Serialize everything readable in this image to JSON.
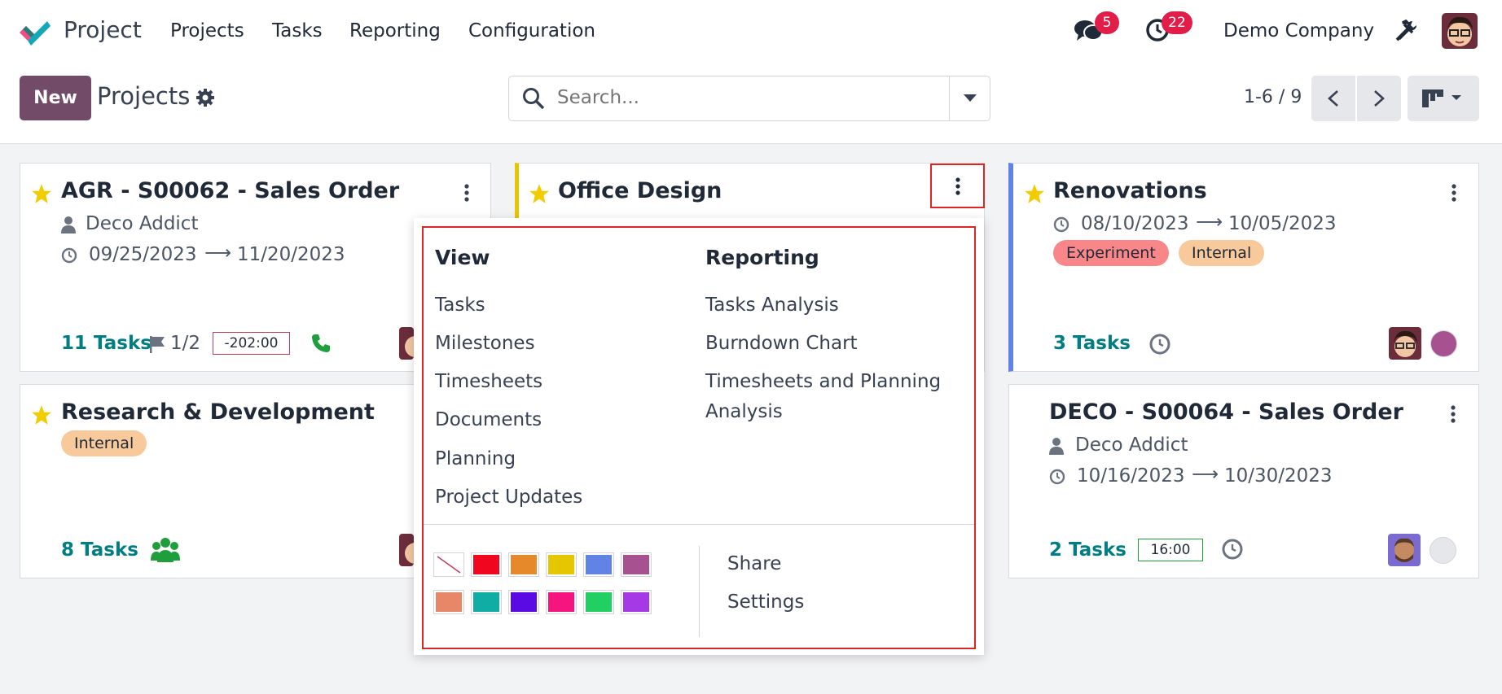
{
  "navbar": {
    "app_name": "Project",
    "menu": [
      "Projects",
      "Tasks",
      "Reporting",
      "Configuration"
    ],
    "messages_count": "5",
    "activities_count": "22",
    "company": "Demo Company"
  },
  "control_panel": {
    "new_label": "New",
    "breadcrumb": "Projects",
    "search_placeholder": "Search...",
    "pager": "1-6 / 9"
  },
  "cards": [
    {
      "title": "AGR - S00062 - Sales Order",
      "customer": "Deco Addict",
      "date_start": "09/25/2023",
      "date_end": "11/20/2023",
      "tasks": "11 Tasks",
      "milestones": "1/2",
      "hours": "-202:00"
    },
    {
      "title": "Office Design"
    },
    {
      "title": "Renovations",
      "date_start": "08/10/2023",
      "date_end": "10/05/2023",
      "tags": [
        "Experiment",
        "Internal"
      ],
      "tasks": "3 Tasks"
    },
    {
      "title": "Research & Development",
      "tags": [
        "Internal"
      ],
      "tasks": "8 Tasks"
    },
    {
      "title": "DECO - S00064 - Sales Order",
      "customer": "Deco Addict",
      "date_start": "10/16/2023",
      "date_end": "10/30/2023",
      "tasks": "2 Tasks",
      "hours": "16:00"
    }
  ],
  "dropdown": {
    "view_heading": "View",
    "view_items": [
      "Tasks",
      "Milestones",
      "Timesheets",
      "Documents",
      "Planning",
      "Project Updates"
    ],
    "reporting_heading": "Reporting",
    "reporting_items": [
      "Tasks Analysis",
      "Burndown Chart",
      "Timesheets and Planning",
      "Analysis"
    ],
    "actions": [
      "Share",
      "Settings"
    ],
    "colors": [
      "#ffffff",
      "#f0061e",
      "#e5892a",
      "#e6c600",
      "#6283e6",
      "#a85191",
      "#e88668",
      "#10ada5",
      "#5a0be3",
      "#f6157e",
      "#22cf63",
      "#a539e6"
    ]
  },
  "colors": {
    "brand": "#714b67",
    "link": "#017e84",
    "badge": "#e11d48",
    "highlight": "#dc2626",
    "tag_experiment": "#f98789",
    "tag_internal": "#f8c99a",
    "renovations_stripe": "#6283e6",
    "office_stripe": "#e6c600"
  }
}
